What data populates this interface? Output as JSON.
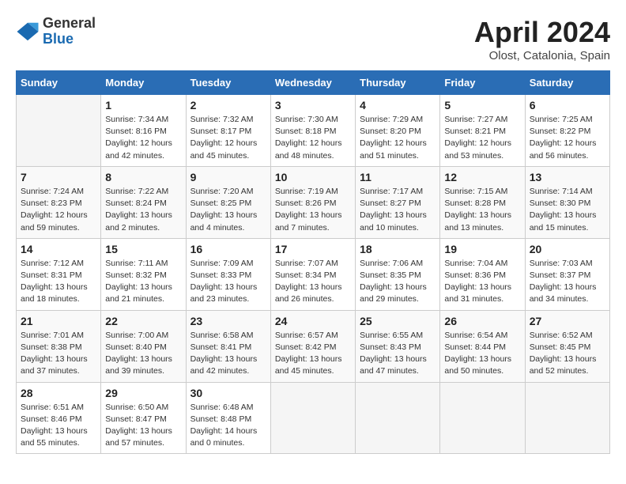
{
  "header": {
    "logo_general": "General",
    "logo_blue": "Blue",
    "month_year": "April 2024",
    "location": "Olost, Catalonia, Spain"
  },
  "days_of_week": [
    "Sunday",
    "Monday",
    "Tuesday",
    "Wednesday",
    "Thursday",
    "Friday",
    "Saturday"
  ],
  "weeks": [
    [
      {
        "day": "",
        "info": ""
      },
      {
        "day": "1",
        "info": "Sunrise: 7:34 AM\nSunset: 8:16 PM\nDaylight: 12 hours\nand 42 minutes."
      },
      {
        "day": "2",
        "info": "Sunrise: 7:32 AM\nSunset: 8:17 PM\nDaylight: 12 hours\nand 45 minutes."
      },
      {
        "day": "3",
        "info": "Sunrise: 7:30 AM\nSunset: 8:18 PM\nDaylight: 12 hours\nand 48 minutes."
      },
      {
        "day": "4",
        "info": "Sunrise: 7:29 AM\nSunset: 8:20 PM\nDaylight: 12 hours\nand 51 minutes."
      },
      {
        "day": "5",
        "info": "Sunrise: 7:27 AM\nSunset: 8:21 PM\nDaylight: 12 hours\nand 53 minutes."
      },
      {
        "day": "6",
        "info": "Sunrise: 7:25 AM\nSunset: 8:22 PM\nDaylight: 12 hours\nand 56 minutes."
      }
    ],
    [
      {
        "day": "7",
        "info": "Sunrise: 7:24 AM\nSunset: 8:23 PM\nDaylight: 12 hours\nand 59 minutes."
      },
      {
        "day": "8",
        "info": "Sunrise: 7:22 AM\nSunset: 8:24 PM\nDaylight: 13 hours\nand 2 minutes."
      },
      {
        "day": "9",
        "info": "Sunrise: 7:20 AM\nSunset: 8:25 PM\nDaylight: 13 hours\nand 4 minutes."
      },
      {
        "day": "10",
        "info": "Sunrise: 7:19 AM\nSunset: 8:26 PM\nDaylight: 13 hours\nand 7 minutes."
      },
      {
        "day": "11",
        "info": "Sunrise: 7:17 AM\nSunset: 8:27 PM\nDaylight: 13 hours\nand 10 minutes."
      },
      {
        "day": "12",
        "info": "Sunrise: 7:15 AM\nSunset: 8:28 PM\nDaylight: 13 hours\nand 13 minutes."
      },
      {
        "day": "13",
        "info": "Sunrise: 7:14 AM\nSunset: 8:30 PM\nDaylight: 13 hours\nand 15 minutes."
      }
    ],
    [
      {
        "day": "14",
        "info": "Sunrise: 7:12 AM\nSunset: 8:31 PM\nDaylight: 13 hours\nand 18 minutes."
      },
      {
        "day": "15",
        "info": "Sunrise: 7:11 AM\nSunset: 8:32 PM\nDaylight: 13 hours\nand 21 minutes."
      },
      {
        "day": "16",
        "info": "Sunrise: 7:09 AM\nSunset: 8:33 PM\nDaylight: 13 hours\nand 23 minutes."
      },
      {
        "day": "17",
        "info": "Sunrise: 7:07 AM\nSunset: 8:34 PM\nDaylight: 13 hours\nand 26 minutes."
      },
      {
        "day": "18",
        "info": "Sunrise: 7:06 AM\nSunset: 8:35 PM\nDaylight: 13 hours\nand 29 minutes."
      },
      {
        "day": "19",
        "info": "Sunrise: 7:04 AM\nSunset: 8:36 PM\nDaylight: 13 hours\nand 31 minutes."
      },
      {
        "day": "20",
        "info": "Sunrise: 7:03 AM\nSunset: 8:37 PM\nDaylight: 13 hours\nand 34 minutes."
      }
    ],
    [
      {
        "day": "21",
        "info": "Sunrise: 7:01 AM\nSunset: 8:38 PM\nDaylight: 13 hours\nand 37 minutes."
      },
      {
        "day": "22",
        "info": "Sunrise: 7:00 AM\nSunset: 8:40 PM\nDaylight: 13 hours\nand 39 minutes."
      },
      {
        "day": "23",
        "info": "Sunrise: 6:58 AM\nSunset: 8:41 PM\nDaylight: 13 hours\nand 42 minutes."
      },
      {
        "day": "24",
        "info": "Sunrise: 6:57 AM\nSunset: 8:42 PM\nDaylight: 13 hours\nand 45 minutes."
      },
      {
        "day": "25",
        "info": "Sunrise: 6:55 AM\nSunset: 8:43 PM\nDaylight: 13 hours\nand 47 minutes."
      },
      {
        "day": "26",
        "info": "Sunrise: 6:54 AM\nSunset: 8:44 PM\nDaylight: 13 hours\nand 50 minutes."
      },
      {
        "day": "27",
        "info": "Sunrise: 6:52 AM\nSunset: 8:45 PM\nDaylight: 13 hours\nand 52 minutes."
      }
    ],
    [
      {
        "day": "28",
        "info": "Sunrise: 6:51 AM\nSunset: 8:46 PM\nDaylight: 13 hours\nand 55 minutes."
      },
      {
        "day": "29",
        "info": "Sunrise: 6:50 AM\nSunset: 8:47 PM\nDaylight: 13 hours\nand 57 minutes."
      },
      {
        "day": "30",
        "info": "Sunrise: 6:48 AM\nSunset: 8:48 PM\nDaylight: 14 hours\nand 0 minutes."
      },
      {
        "day": "",
        "info": ""
      },
      {
        "day": "",
        "info": ""
      },
      {
        "day": "",
        "info": ""
      },
      {
        "day": "",
        "info": ""
      }
    ]
  ]
}
